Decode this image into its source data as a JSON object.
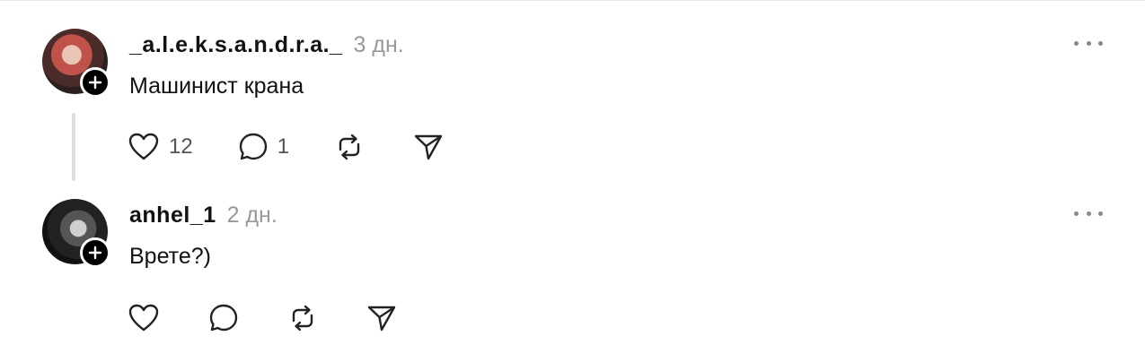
{
  "comments": [
    {
      "username": "_a.l.e.k.s.a.n.d.r.a._",
      "timestamp": "3 дн.",
      "text": "Машинист крана",
      "likes": "12",
      "replies": "1"
    },
    {
      "username": "anhel_1",
      "timestamp": "2 дн.",
      "text": "Врете?)",
      "likes": "",
      "replies": ""
    }
  ],
  "icons": {
    "like": "heart-icon",
    "reply": "speech-bubble-icon",
    "repost": "repost-icon",
    "share": "send-icon",
    "more": "more-icon",
    "follow": "plus-icon"
  }
}
